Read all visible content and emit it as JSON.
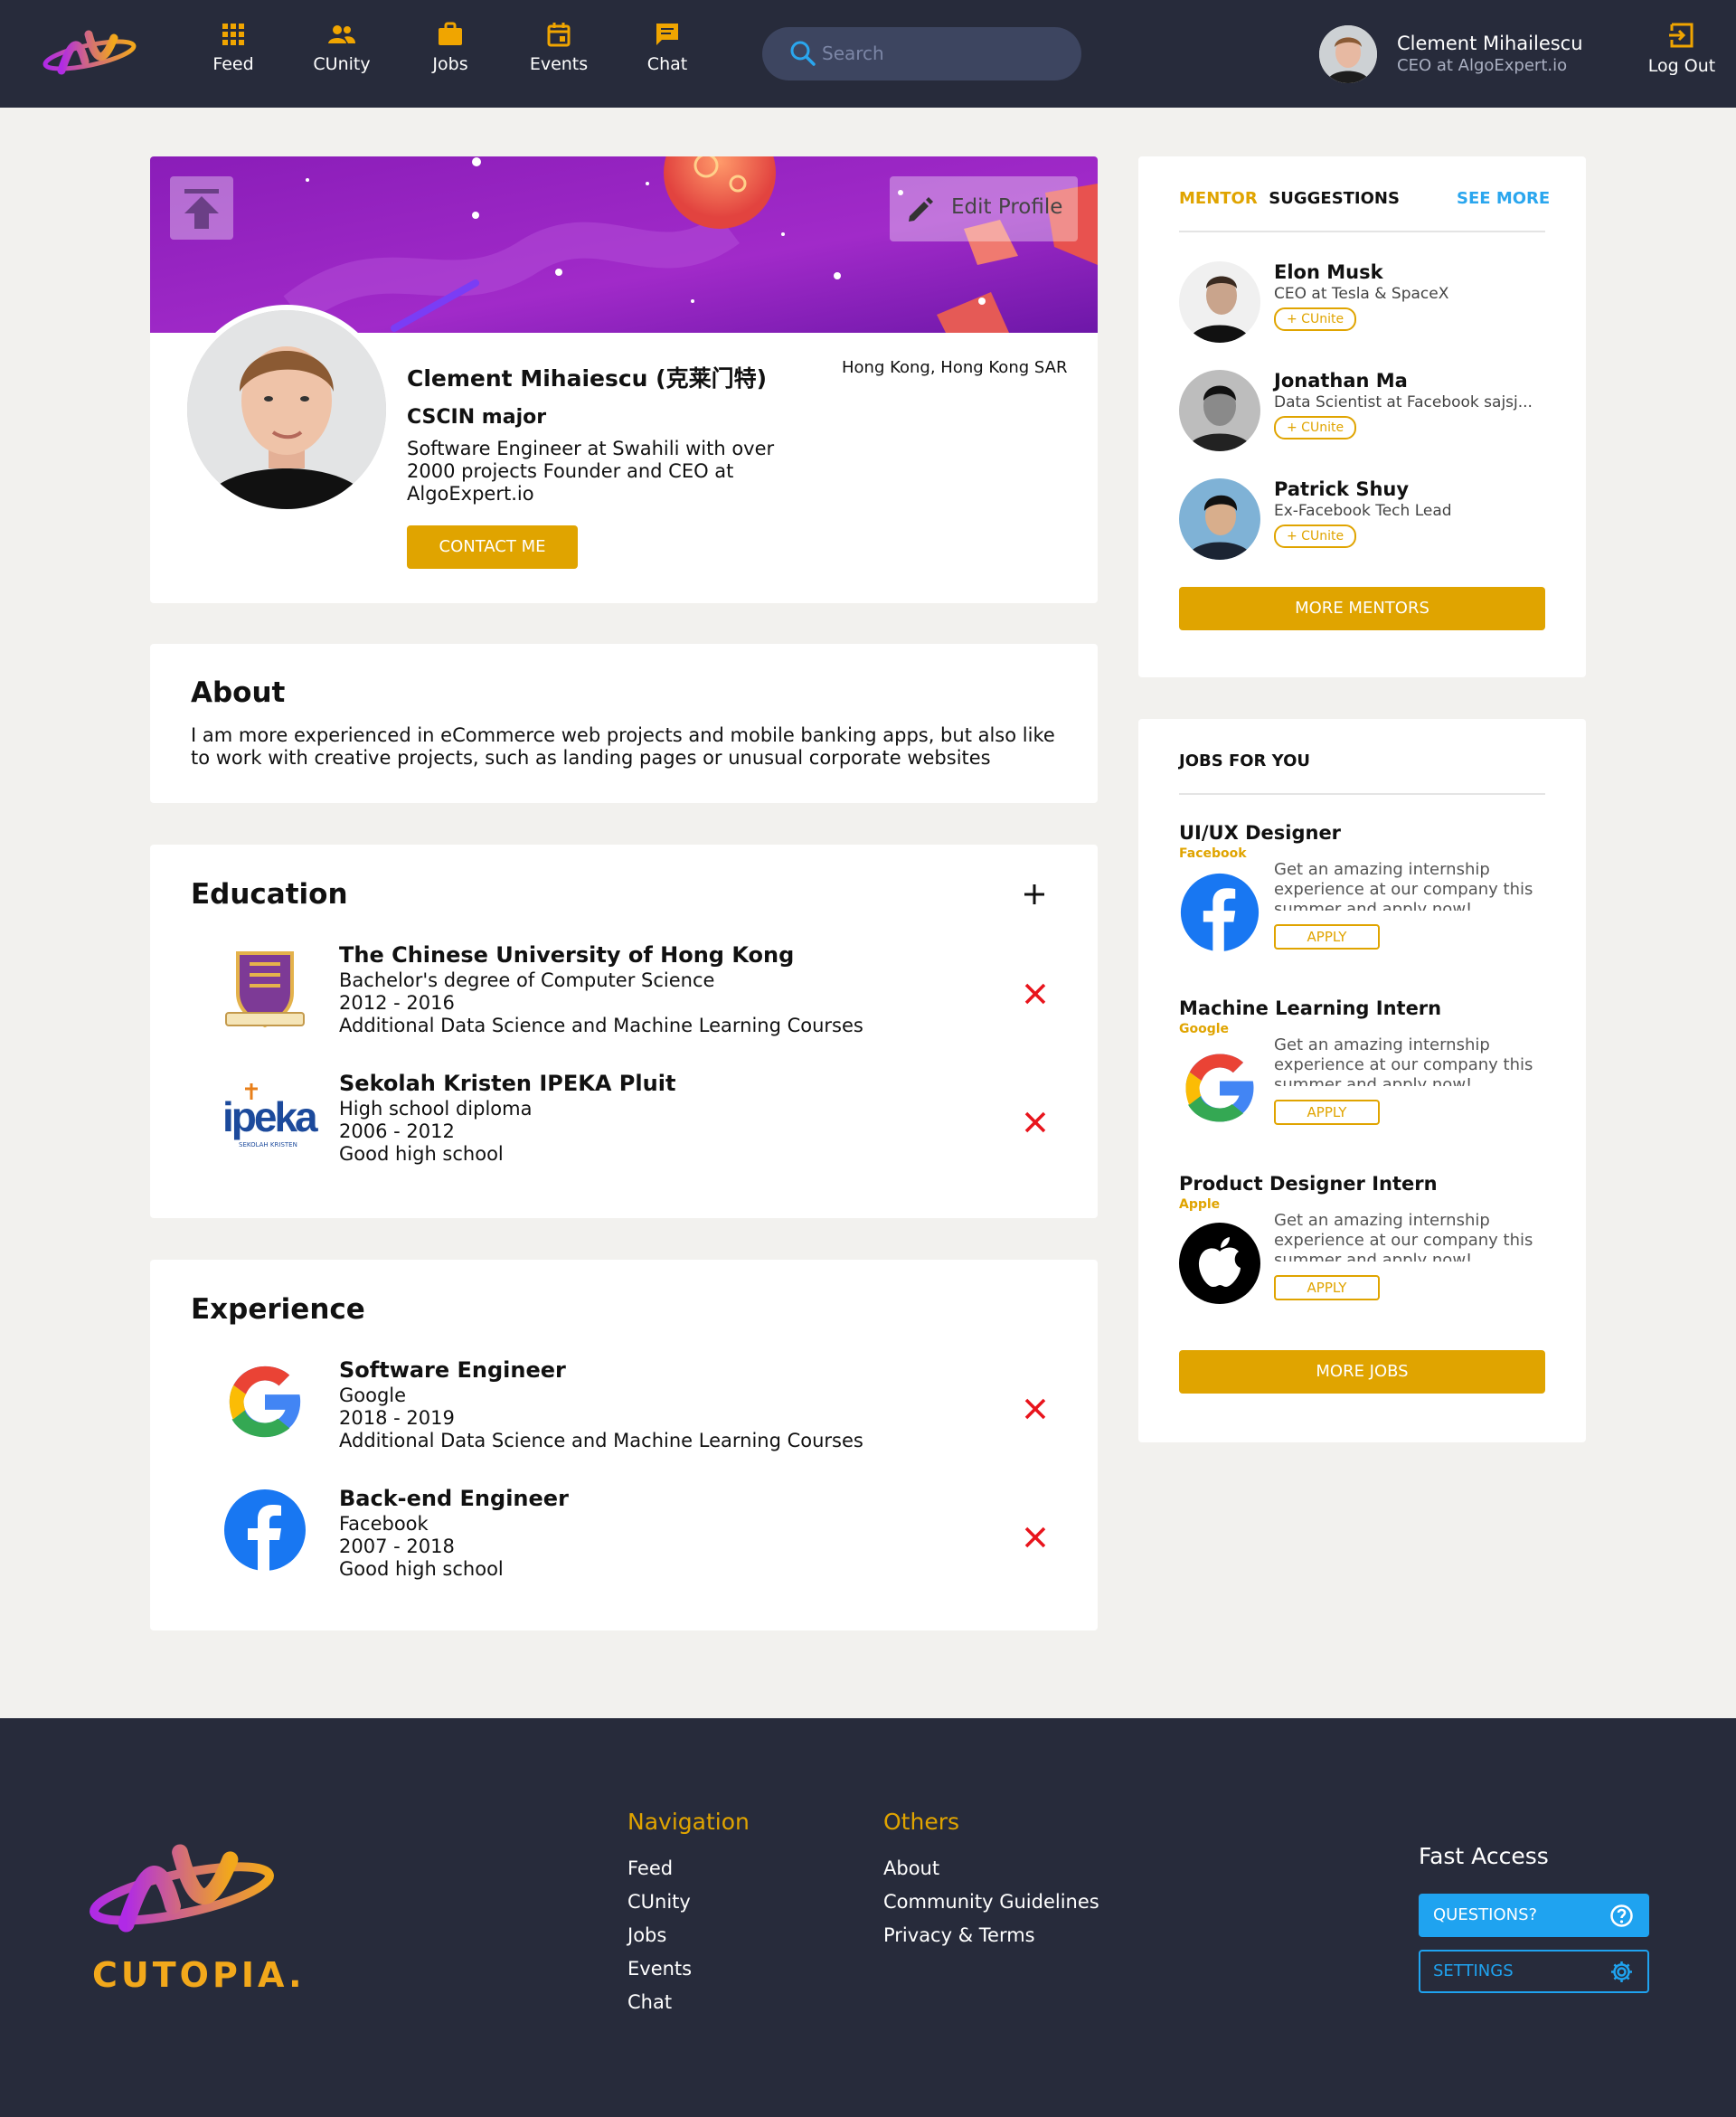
{
  "nav": {
    "items": [
      {
        "label": "Feed",
        "icon": "grid-icon"
      },
      {
        "label": "CUnity",
        "icon": "people-icon"
      },
      {
        "label": "Jobs",
        "icon": "briefcase-icon"
      },
      {
        "label": "Events",
        "icon": "calendar-icon"
      },
      {
        "label": "Chat",
        "icon": "chat-icon"
      }
    ],
    "search_placeholder": "Search",
    "user_name": "Clement Mihailescu",
    "user_title": "CEO at AlgoExpert.io",
    "logout_label": "Log Out"
  },
  "profile": {
    "edit_label": "Edit Profile",
    "name": "Clement Mihaiescu (克莱门特)",
    "location": "Hong Kong, Hong Kong SAR",
    "major": "CSCIN major",
    "bio": "Software Engineer at Swahili with over 2000 projects Founder and CEO at AlgoExpert.io",
    "contact_label": "CONTACT ME"
  },
  "about": {
    "title": "About",
    "text": "I am more experienced in eCommerce web projects and mobile banking apps, but also like to work with creative projects, such as landing pages or unusual corporate websites"
  },
  "education": {
    "title": "Education",
    "items": [
      {
        "school": "The Chinese University of Hong Kong",
        "degree": "Bachelor's degree of Computer Science",
        "years": "2012 - 2016",
        "note": "Additional Data Science and Machine Learning Courses"
      },
      {
        "school": "Sekolah Kristen IPEKA Pluit",
        "degree": "High school diploma",
        "years": "2006 - 2012",
        "note": "Good high school",
        "logo_text": "ipeka",
        "logo_sub": "SEKOLAH KRISTEN"
      }
    ]
  },
  "experience": {
    "title": "Experience",
    "items": [
      {
        "role": "Software Engineer",
        "company": "Google",
        "years": "2018 - 2019",
        "note": "Additional Data Science and Machine Learning Courses"
      },
      {
        "role": "Back-end Engineer",
        "company": "Facebook",
        "years": "2007 - 2018",
        "note": "Good high school"
      }
    ]
  },
  "mentors": {
    "title_accent": "MENTOR",
    "title_rest": "SUGGESTIONS",
    "see_more": "SEE MORE",
    "cunite_label": "+ CUnite",
    "items": [
      {
        "name": "Elon Musk",
        "title": "CEO at Tesla & SpaceX"
      },
      {
        "name": "Jonathan Ma",
        "title": "Data Scientist at Facebook sajsj..."
      },
      {
        "name": "Patrick Shuy",
        "title": "Ex-Facebook Tech Lead"
      }
    ],
    "more_label": "MORE MENTORS"
  },
  "jobs": {
    "title": "JOBS FOR YOU",
    "apply_label": "APPLY",
    "items": [
      {
        "title": "UI/UX Designer",
        "company": "Facebook",
        "desc": "Get an amazing internship experience at our company this summer and apply now!"
      },
      {
        "title": "Machine Learning Intern",
        "company": "Google",
        "desc": "Get an amazing internship experience at our company this summer and apply now!"
      },
      {
        "title": "Product Designer Intern",
        "company": "Apple",
        "desc": "Get an amazing internship experience at our company this summer and apply now!"
      }
    ],
    "more_label": "MORE JOBS"
  },
  "footer": {
    "logo_text": "CUTOPIA.",
    "nav_title": "Navigation",
    "nav_links": [
      "Feed",
      "CUnity",
      "Jobs",
      "Events",
      "Chat"
    ],
    "others_title": "Others",
    "others_links": [
      "About",
      "Community Guidelines",
      "Privacy & Terms"
    ],
    "fast_title": "Fast Access",
    "questions_label": "QUESTIONS?",
    "settings_label": "SETTINGS"
  },
  "colors": {
    "nav_bg": "#272b3b",
    "accent_gold": "#e0a400",
    "accent_blue": "#2aa6ee",
    "delete_red": "#e8141c"
  }
}
